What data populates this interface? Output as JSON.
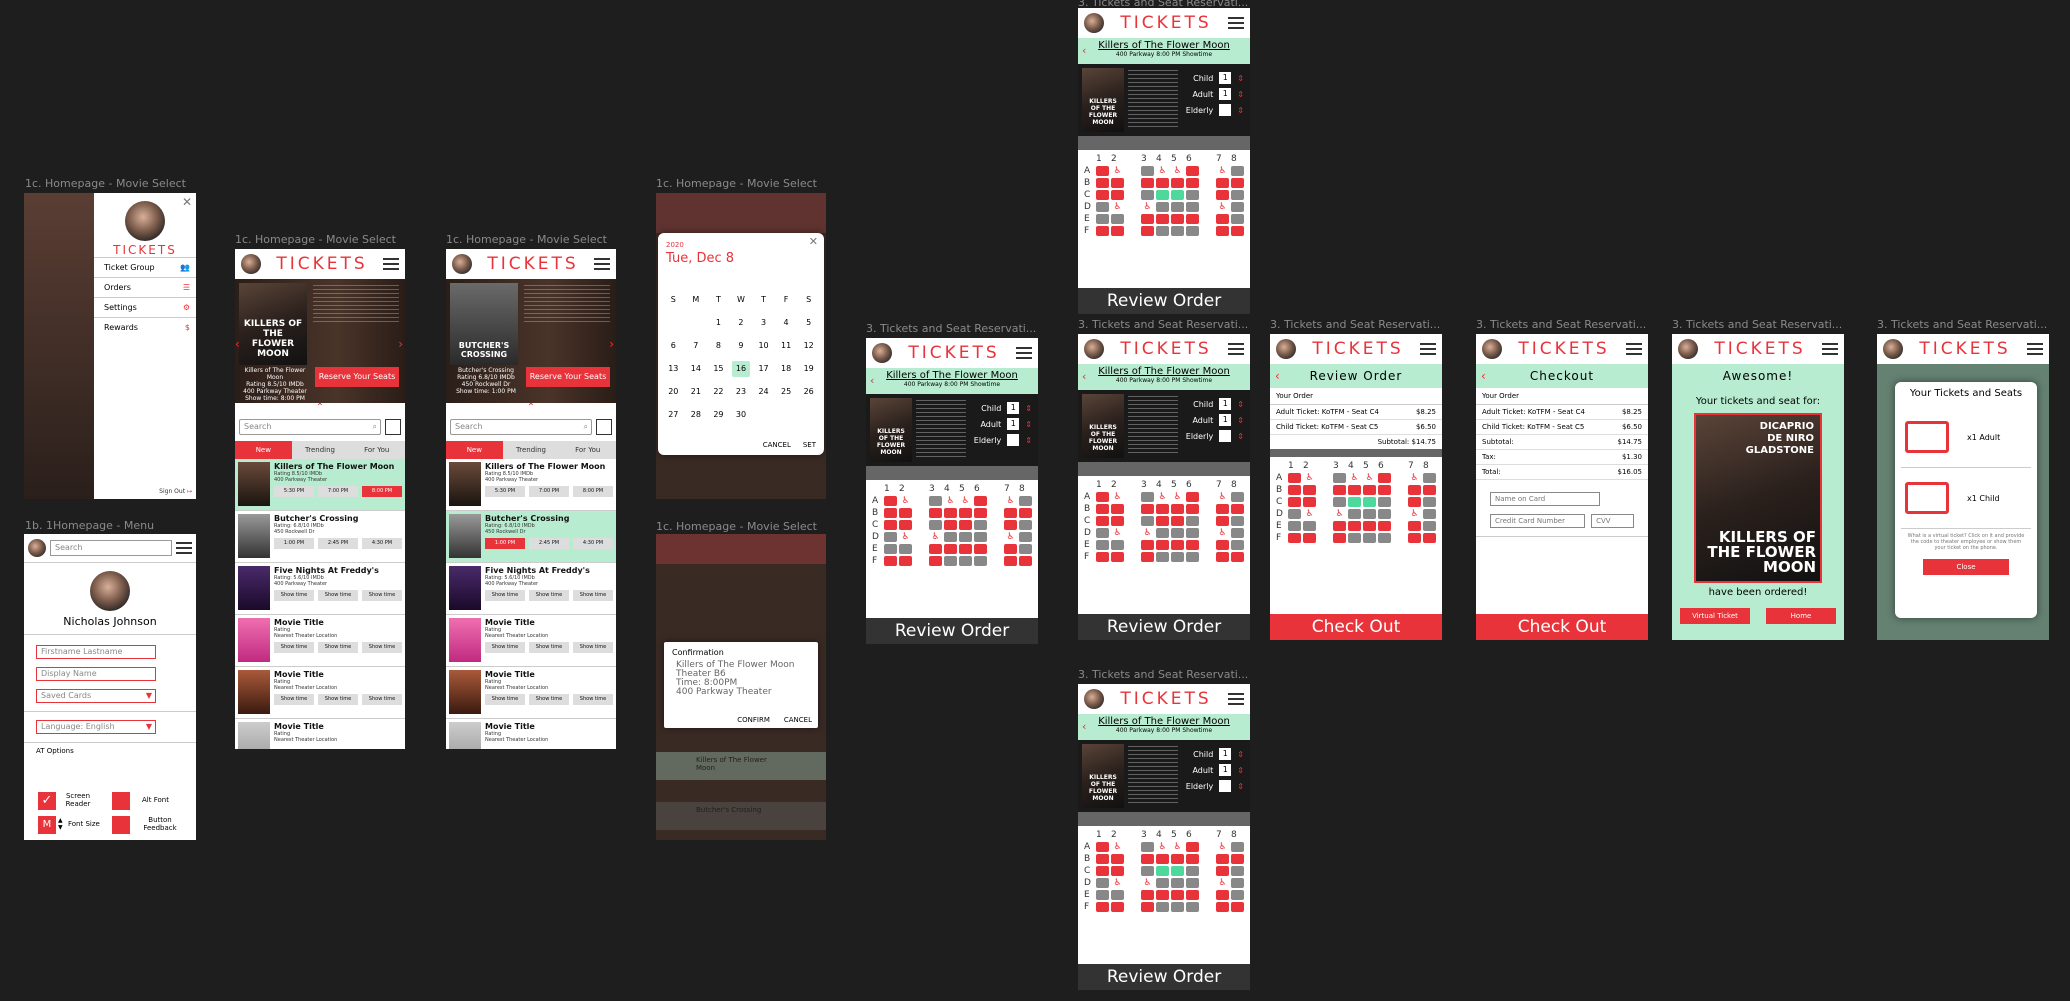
{
  "frame_labels": {
    "home_menu": "1c. Homepage - Movie Select",
    "homepage_a": "1c. Homepage - Movie Select",
    "homepage_b": "1c. Homepage - Movie Select",
    "calendar": "1c. Homepage - Movie Select",
    "confirmation": "1c. Homepage - Movie Select",
    "profile_menu": "1b. 1Homepage - Menu",
    "seats_1": "3. Tickets and Seat Reservati...",
    "seats_2": "3. Tickets and Seat Reservati...",
    "seats_top": "3. Tickets and Seat Reservati...",
    "seats_bottom": "3. Tickets and Seat Reservati...",
    "review": "3. Tickets and Seat Reservati...",
    "checkout": "3. Tickets and Seat Reservati...",
    "awesome": "3. Tickets and Seat Reservati...",
    "your_tickets": "3. Tickets and Seat Reservati..."
  },
  "brand": {
    "title": "TICKETS",
    "accent": "#e8333b",
    "mint": "#b7ecd0"
  },
  "menu": {
    "brand": "TICKETS",
    "items": [
      "Ticket Group",
      "Orders",
      "Settings",
      "Rewards"
    ],
    "sign_out": "Sign Out"
  },
  "profile": {
    "search_placeholder": "Search",
    "name": "Nicholas Johnson",
    "name_placeholder": "Firstname Lastname",
    "display_placeholder": "Display Name",
    "saved_cards": "Saved Cards",
    "language": "Language: English",
    "at_options": "AT Options",
    "screen_reader": "Screen Reader",
    "alt_font": "Alt Font",
    "font_size": "Font Size",
    "font_size_letter": "M",
    "button_feedback": "Button Feedback"
  },
  "homepage_a": {
    "hero_title": "KILLERS OF THE FLOWER MOON",
    "hero_caption": "Killers of The Flower Moon",
    "hero_rating": "Rating 8.5/10 IMDb",
    "hero_theater": "400 Parkway Theater",
    "hero_showtime": "Show time: 8:00 PM",
    "reserve": "Reserve Your Seats",
    "search": "Search",
    "tabs": [
      "New",
      "Trending",
      "For You"
    ]
  },
  "homepage_b": {
    "hero_title": "BUTCHER'S CROSSING",
    "hero_caption": "Butcher's Crossing",
    "hero_rating": "Rating 6.8/10 IMDb",
    "hero_theater": "450 Rockwell Dr",
    "hero_showtime": "Show time: 1:00 PM",
    "reserve": "Reserve Your Seats",
    "search": "Search",
    "tabs": [
      "New",
      "Trending",
      "For You"
    ]
  },
  "movies": [
    {
      "title": "Killers of The Flower Moon",
      "rating": "Rating 8.5/10 IMDb",
      "loc": "400 Parkway Theater",
      "times": [
        "5:30 PM",
        "7:00 PM",
        "8:00 PM"
      ]
    },
    {
      "title": "Butcher's Crossing",
      "rating": "Rating: 6.8/10 IMDb",
      "loc": "450 Rockwell Dr",
      "times": [
        "1:00 PM",
        "2:45 PM",
        "4:30 PM"
      ]
    },
    {
      "title": "Five Nights At Freddy's",
      "rating": "Rating: 5.6/10 IMDb",
      "loc": "400 Parkway Theater",
      "times": [
        "Show time",
        "Show time",
        "Show time"
      ]
    },
    {
      "title": "Movie Title",
      "rating": "Rating",
      "loc": "Nearest Theater Location",
      "times": [
        "Show time",
        "Show time",
        "Show time"
      ]
    },
    {
      "title": "Movie Title",
      "rating": "Rating",
      "loc": "Nearest Theater Location",
      "times": [
        "Show time",
        "Show time",
        "Show time"
      ]
    },
    {
      "title": "Movie Title",
      "rating": "Rating",
      "loc": "Nearest Theater Location",
      "times": []
    }
  ],
  "calendar": {
    "year": "2020",
    "date": "Tue, Dec 8",
    "weekdays": [
      "S",
      "M",
      "T",
      "W",
      "T",
      "F",
      "S"
    ],
    "rows": [
      [
        "",
        "",
        "1",
        "2",
        "3",
        "4",
        "5"
      ],
      [
        "6",
        "7",
        "8",
        "9",
        "10",
        "11",
        "12"
      ],
      [
        "13",
        "14",
        "15",
        "16",
        "17",
        "18",
        "19"
      ],
      [
        "20",
        "21",
        "22",
        "23",
        "24",
        "25",
        "26"
      ],
      [
        "27",
        "28",
        "29",
        "30",
        "",
        "",
        ""
      ]
    ],
    "selected": "16",
    "cancel": "CANCEL",
    "set": "SET"
  },
  "confirmation": {
    "title": "Confirmation",
    "line1": "Killers of The Flower Moon",
    "line2": "Theater B6",
    "line3": "Time: 8:00PM",
    "line4": "400 Parkway Theater",
    "confirm": "CONFIRM",
    "cancel": "CANCEL",
    "bg_item1": "Killers of The Flower Moon",
    "bg_item2": "Butcher's Crossing"
  },
  "seats": {
    "movie": "Killers of The Flower Moon",
    "sub": "400 Parkway 8:00 PM Showtime",
    "poster_title": "KILLERS OF THE FLOWER MOON",
    "child": "Child",
    "adult": "Adult",
    "elderly": "Elderly",
    "child_qty": "1",
    "adult_qty": "1",
    "columns": [
      "1",
      "2",
      "",
      "3",
      "4",
      "5",
      "6",
      "",
      "7",
      "8"
    ],
    "rows": [
      "A",
      "B",
      "C",
      "D",
      "E",
      "F"
    ],
    "review": "Review Order",
    "checkout": "Check Out"
  },
  "review": {
    "title": "Review Order",
    "your_order": "Your Order",
    "line1": "Adult Ticket: KoTFM - Seat C4",
    "price1": "$8.25",
    "line2": "Child Ticket: KoTFM - Seat C5",
    "price2": "$6.50",
    "subtotal": "Subtotal: $14.75",
    "button": "Check Out"
  },
  "checkout": {
    "title": "Checkout",
    "your_order": "Your Order",
    "line1": "Adult Ticket: KoTFM - Seat C4",
    "price1": "$8.25",
    "line2": "Child Ticket: KoTFM - Seat C5",
    "price2": "$6.50",
    "subtotal_label": "Subtotal:",
    "subtotal": "$14.75",
    "tax_label": "Tax:",
    "tax": "$1.30",
    "total_label": "Total:",
    "total": "$16.05",
    "name_ph": "Name on Card",
    "cc_ph": "Credit Card Number",
    "cvv_ph": "CVV",
    "button": "Check Out"
  },
  "awesome": {
    "title": "Awesome!",
    "top": "Your tickets and seat for:",
    "poster_top": "DICAPRIO",
    "poster_mid": "DE NIRO",
    "poster_low": "GLADSTONE",
    "poster_title": "KILLERS OF THE FLOWER MOON",
    "bottom": "have been ordered!",
    "virtual": "Virtual Ticket",
    "home": "Home"
  },
  "your_tickets": {
    "title": "Your Tickets and Seats",
    "adult": "x1 Adult",
    "child": "x1 Child",
    "note": "What is a virtual ticket? Click on it and provide the code to theater employee or show them your ticket on the phone.",
    "close": "Close"
  }
}
